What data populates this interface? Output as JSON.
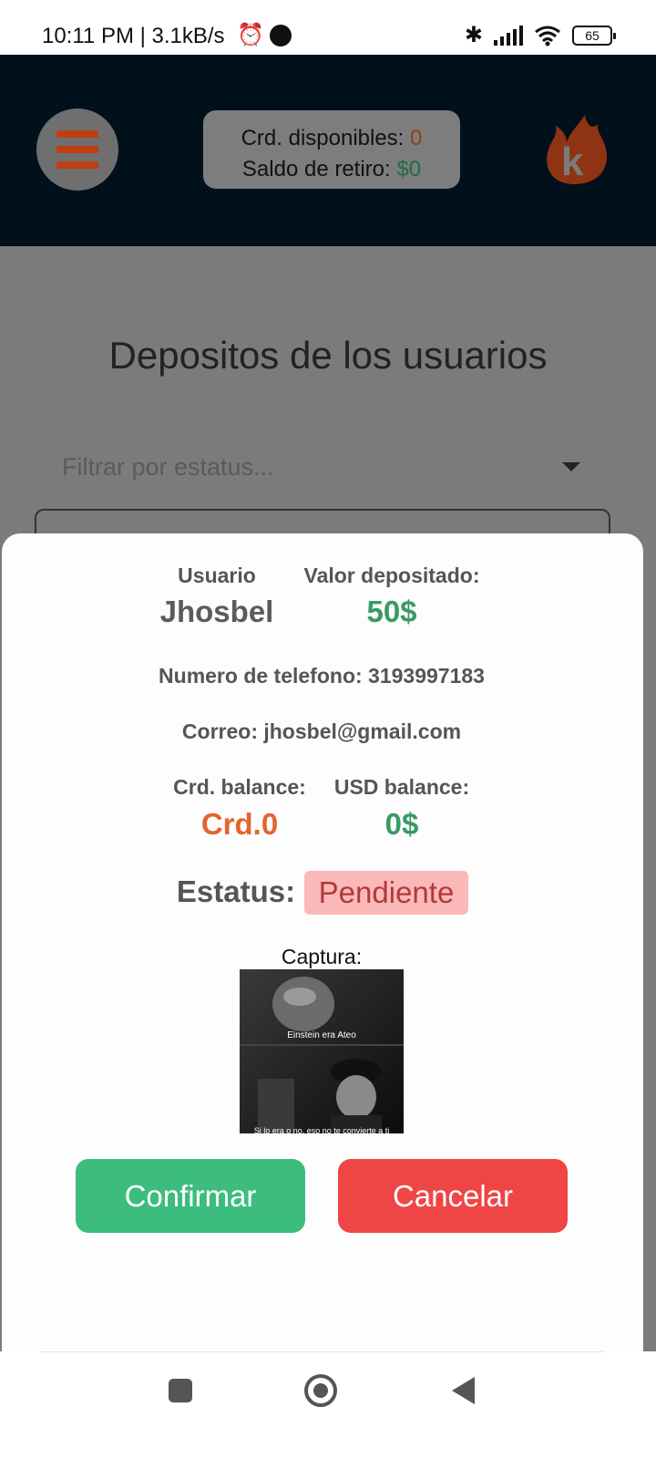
{
  "status_bar": {
    "time": "10:11 PM | 3.1kB/s",
    "battery": "65"
  },
  "header": {
    "credits_label": "Crd. disponibles: ",
    "credits_value": "0",
    "withdraw_label": "Saldo de retiro: ",
    "withdraw_value": "$0",
    "logo_letter": "k",
    "colors": {
      "accent_orange": "#e4642f",
      "accent_green": "#3a9a62",
      "header_bg": "#00111c"
    }
  },
  "page": {
    "title": "Depositos de los usuarios",
    "filter_placeholder": "Filtrar por estatus..."
  },
  "modal": {
    "user_label": "Usuario",
    "user_value": "Jhosbel",
    "deposit_label": "Valor depositado:",
    "deposit_value": "50$",
    "phone_label": "Numero de telefono: 3193997183",
    "email_label": "Correo: jhosbel@gmail.com",
    "crd_balance_label": "Crd. balance:",
    "crd_balance_value": "Crd.0",
    "usd_balance_label": "USD balance:",
    "usd_balance_value": "0$",
    "status_label": "Estatus:",
    "status_value": "Pendiente",
    "capture_label": "Captura:",
    "capture_caption_top": "Einstein era Ateo",
    "capture_caption_bottom": "Si lo era o no, eso no te convierte a ti",
    "confirm_label": "Confirmar",
    "cancel_label": "Cancelar"
  }
}
